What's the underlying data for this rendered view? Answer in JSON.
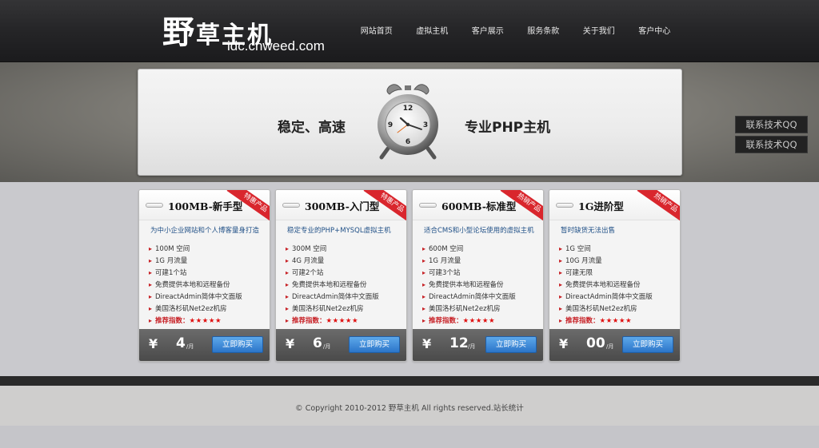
{
  "header": {
    "logo_big": "野",
    "logo_rest": "草主机",
    "logo_domain": "idc.cnweed.com",
    "nav": [
      "网站首页",
      "虚拟主机",
      "客户展示",
      "服务条款",
      "关于我们",
      "客户中心"
    ]
  },
  "banner": {
    "left_text": "稳定、高速",
    "right_text": "专业PHP主机",
    "clock_numbers": [
      "12",
      "3",
      "6",
      "9"
    ]
  },
  "qq_buttons": [
    "联系技术QQ",
    "联系技术QQ"
  ],
  "cards": [
    {
      "title": "100MB-新手型",
      "ribbon": "特惠产品",
      "subtitle": "为中小企业网站和个人博客量身打造",
      "features": [
        "100M 空间",
        "1G 月流量",
        "可建1个站",
        "免费提供本地和远程备份",
        "DireactAdmin简体中文面版",
        "美国洛杉矶Net2ez机房"
      ],
      "recommend_label": "推荐指数：",
      "stars": "★★★★★",
      "currency": "¥",
      "price": "4",
      "per": "/月",
      "buy_label": "立即购买"
    },
    {
      "title": "300MB-入门型",
      "ribbon": "特惠产品",
      "subtitle": "稳定专业的PHP+MYSQL虚拟主机",
      "features": [
        "300M 空间",
        "4G 月流量",
        "可建2个站",
        "免费提供本地和远程备份",
        "DireactAdmin简体中文面版",
        "美国洛杉矶Net2ez机房"
      ],
      "recommend_label": "推荐指数：",
      "stars": "★★★★★",
      "currency": "¥",
      "price": "6",
      "per": "/月",
      "buy_label": "立即购买"
    },
    {
      "title": "600MB-标准型",
      "ribbon": "热销产品",
      "subtitle": "适合CMS和小型论坛使用的虚拟主机",
      "features": [
        "600M 空间",
        "1G 月流量",
        "可建3个站",
        "免费提供本地和远程备份",
        "DireactAdmin简体中文面版",
        "美国洛杉矶Net2ez机房"
      ],
      "recommend_label": "推荐指数：",
      "stars": "★★★★★",
      "currency": "¥",
      "price": "12",
      "per": "/月",
      "buy_label": "立即购买"
    },
    {
      "title": "1G进阶型",
      "ribbon": "热销产品",
      "subtitle": "暂时缺货无法出售",
      "features": [
        "1G 空间",
        "10G 月流量",
        "可建无限",
        "免费提供本地和远程备份",
        "DireactAdmin简体中文面版",
        "美国洛杉矶Net2ez机房"
      ],
      "recommend_label": "推荐指数：",
      "stars": "★★★★★",
      "currency": "¥",
      "price": "00",
      "per": "/月",
      "buy_label": "立即购买"
    }
  ],
  "footer": {
    "copyright": "© Copyright 2010-2012 野草主机 All rights reserved.站长统计"
  },
  "colors": {
    "ribbon": "#d9262d",
    "buy_button": "#2b75c9",
    "subtitle": "#1f4f86",
    "header": "#252527"
  }
}
